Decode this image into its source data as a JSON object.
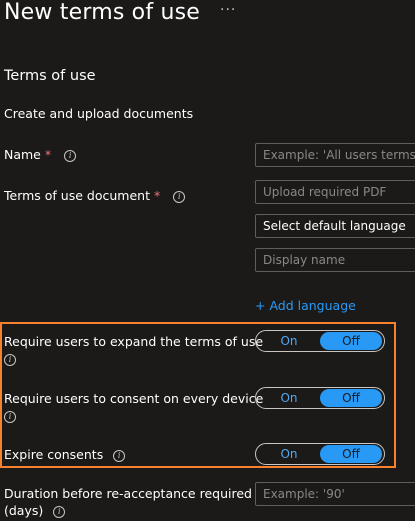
{
  "header": {
    "title": "New terms of use",
    "more_icon": "ellipsis-icon",
    "more": "···"
  },
  "section": {
    "title": "Terms of use",
    "subtitle": "Create and upload documents"
  },
  "form": {
    "name": {
      "label": "Name",
      "required": "*",
      "info_icon": "info-icon",
      "placeholder": "Example: 'All users terms of use'"
    },
    "document": {
      "label": "Terms of use document",
      "required": "*",
      "info_icon": "info-icon",
      "upload_placeholder": "Upload required PDF",
      "language_value": "Select default language",
      "display_name_placeholder": "Display name"
    },
    "add_language": "+ Add language",
    "toggles": [
      {
        "label": "Require users to expand the terms of use",
        "on": "On",
        "off": "Off",
        "selected": "Off"
      },
      {
        "label": "Require users to consent on every device",
        "on": "On",
        "off": "Off",
        "selected": "Off"
      },
      {
        "label": "Expire consents",
        "on": "On",
        "off": "Off",
        "selected": "Off"
      }
    ],
    "duration": {
      "label_line1": "Duration before re-acceptance required",
      "label_line2": "(days)",
      "info_icon": "info-icon",
      "placeholder": "Example: '90'"
    }
  },
  "colors": {
    "background": "#1b1a19",
    "accent": "#2899f5",
    "highlight_border": "#f7812d",
    "required": "#f1707b"
  }
}
